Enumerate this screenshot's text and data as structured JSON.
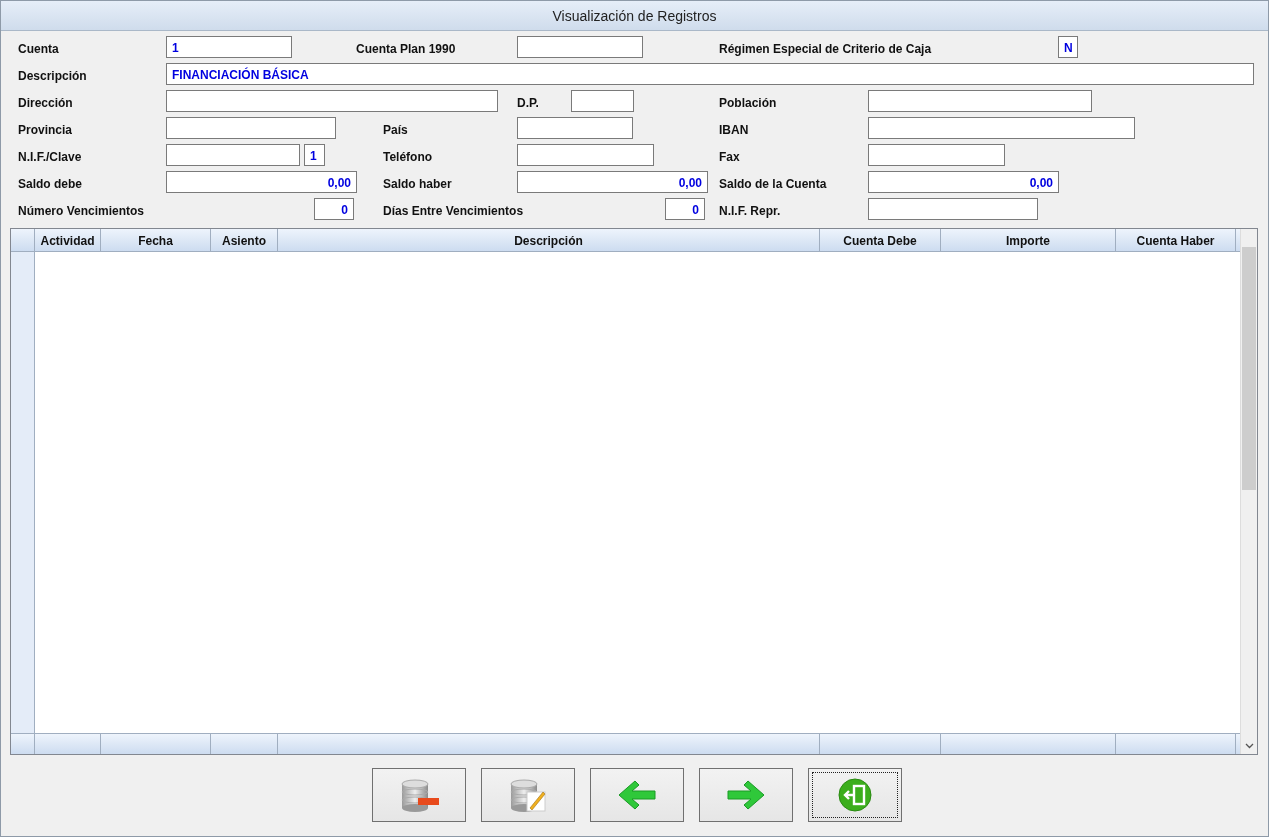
{
  "window": {
    "title": "Visualización de Registros"
  },
  "form": {
    "fields": [
      {
        "label": "Cuenta",
        "value": "1"
      },
      {
        "label": "Cuenta Plan 1990"
      },
      {
        "label": "Régimen Especial de Criterio de Caja",
        "value": "N"
      },
      {
        "label": "Descripción",
        "value": "FINANCIACIÓN BÁSICA"
      },
      {
        "label": "Dirección"
      },
      {
        "label": "D.P."
      },
      {
        "label": "Población"
      },
      {
        "label": "Provincia"
      },
      {
        "label": "País"
      },
      {
        "label": "IBAN"
      },
      {
        "label": "N.I.F./Clave",
        "suffix_value": "1"
      },
      {
        "label": "Teléfono"
      },
      {
        "label": "Fax"
      },
      {
        "label": "Saldo debe",
        "value": "0,00"
      },
      {
        "label": "Saldo haber",
        "value": "0,00"
      },
      {
        "label": "Saldo de la Cuenta",
        "value": "0,00"
      },
      {
        "label": "Número Vencimientos",
        "value": "0"
      },
      {
        "label": "Días Entre Vencimientos",
        "value": "0"
      },
      {
        "label": "N.I.F. Repr."
      }
    ]
  },
  "table": {
    "columns": [
      "Actividad",
      "Fecha",
      "Asiento",
      "Descripción",
      "Cuenta Debe",
      "Importe",
      "Cuenta Haber"
    ]
  },
  "buttons": [
    {
      "kind": "delete",
      "focused": false
    },
    {
      "kind": "edit",
      "focused": false
    },
    {
      "kind": "previous",
      "focused": false
    },
    {
      "kind": "next",
      "focused": false
    },
    {
      "kind": "exit",
      "focused": true
    }
  ]
}
